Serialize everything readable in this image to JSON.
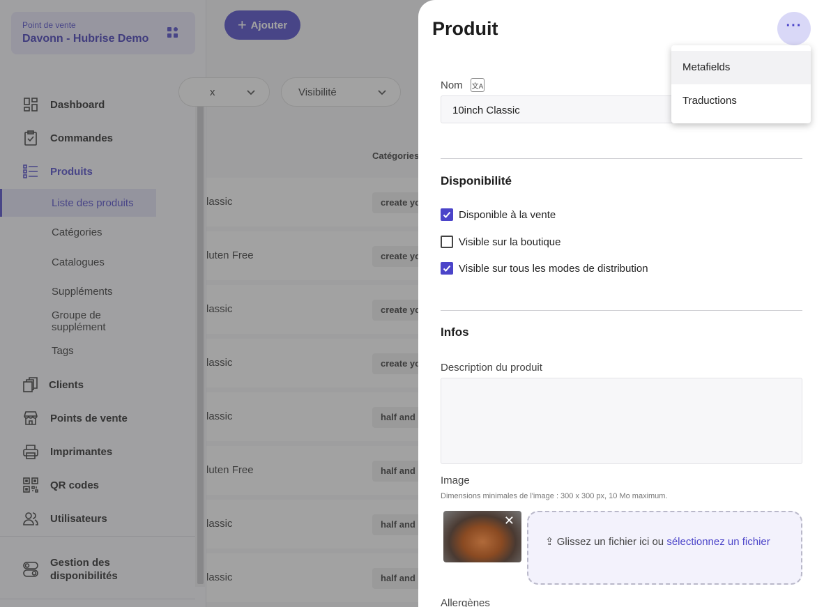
{
  "sidebar": {
    "pos_label": "Point de vente",
    "pos_name": "Davonn - Hubrise Demo",
    "nav": {
      "dashboard": "Dashboard",
      "commandes": "Commandes",
      "produits": "Produits",
      "clients": "Clients",
      "points_de_vente": "Points de vente",
      "imprimantes": "Imprimantes",
      "qr_codes": "QR codes",
      "utilisateurs": "Utilisateurs",
      "gestion_line1": "Gestion des",
      "gestion_line2": "disponibilités"
    },
    "sub": {
      "liste": "Liste des produits",
      "categories": "Catégories",
      "catalogues": "Catalogues",
      "supplements": "Suppléments",
      "groupe": "Groupe de supplément",
      "tags": "Tags"
    }
  },
  "main": {
    "add_label": "Ajouter",
    "filters": [
      "x",
      "Visibilité"
    ],
    "column_header": "Catégories",
    "rows": [
      {
        "name": "lassic",
        "cat": "create yo"
      },
      {
        "name": "luten Free",
        "cat": "create yo"
      },
      {
        "name": "lassic",
        "cat": "create yo"
      },
      {
        "name": "lassic",
        "cat": "create yo"
      },
      {
        "name": "lassic",
        "cat": "half and"
      },
      {
        "name": "luten Free",
        "cat": "half and"
      },
      {
        "name": "lassic",
        "cat": "half and"
      },
      {
        "name": "lassic",
        "cat": "half and"
      }
    ]
  },
  "drawer": {
    "title": "Produit",
    "more_label": "···",
    "nom_label": "Nom",
    "translate_icon_text": "文A",
    "nom_value": "10inch Classic",
    "disponibilite_title": "Disponibilité",
    "checkboxes": [
      {
        "label": "Disponible à la vente",
        "checked": true
      },
      {
        "label": "Visible sur la boutique",
        "checked": false
      },
      {
        "label": "Visible sur tous les modes de distribution",
        "checked": true
      }
    ],
    "infos_title": "Infos",
    "description_label": "Description du produit",
    "description_value": "",
    "image_label": "Image",
    "image_hint": "Dimensions minimales de l'image : 300 x 300 px, 10 Mo maximum.",
    "drop_text": "Glissez un fichier ici ou",
    "drop_link": "sélectionnez un fichier",
    "allergenes_label": "Allergènes"
  },
  "menu": {
    "items": [
      "Metafields",
      "Traductions"
    ]
  },
  "colors": {
    "accent": "#4b44c9",
    "accent_light": "#d9d8f7"
  }
}
